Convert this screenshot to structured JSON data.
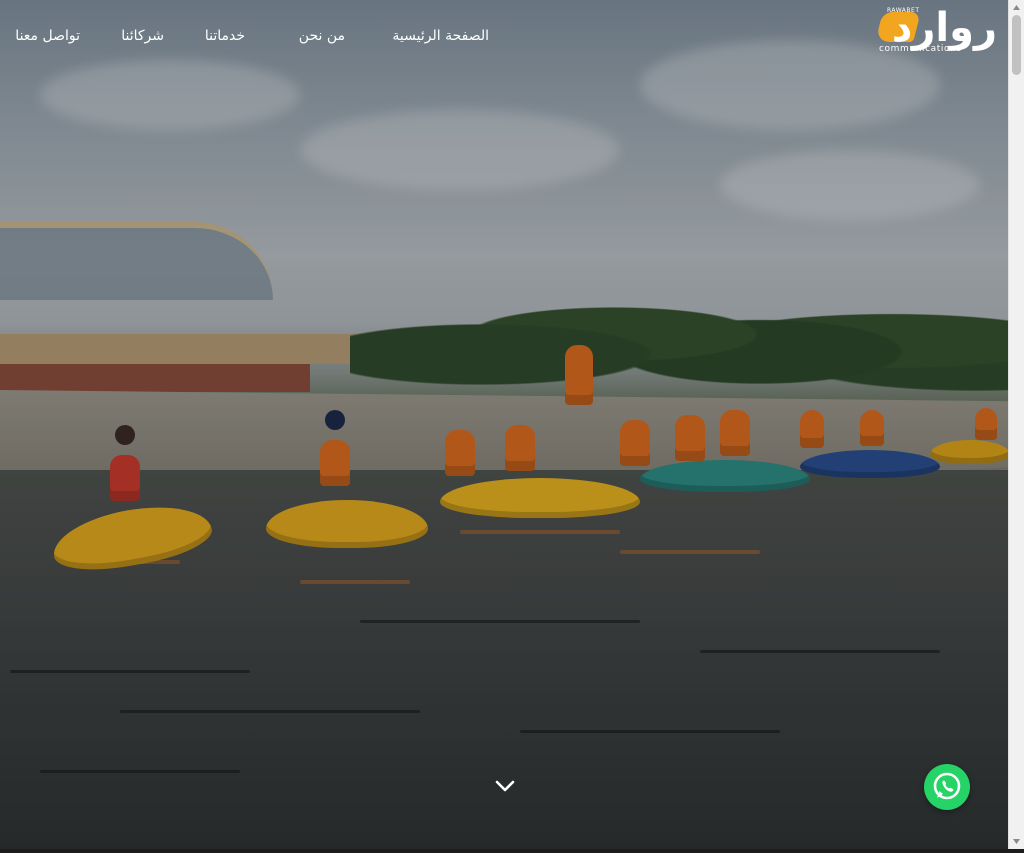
{
  "brand": {
    "logo_text": "روارد",
    "logo_top_text": "RAWABET",
    "logo_sub_text": "communications",
    "accent_color": "#f2a51f"
  },
  "nav": {
    "items": [
      {
        "label": "الصفحة الرئيسية"
      },
      {
        "label": "من نحن"
      },
      {
        "label": "خدماتنا"
      },
      {
        "label": "شركائنا"
      },
      {
        "label": "تواصل معنا"
      }
    ]
  },
  "hero": {
    "scroll_icon": "chevron-down-icon"
  },
  "floating": {
    "whatsapp_icon": "whatsapp-icon",
    "whatsapp_color": "#25d366"
  }
}
